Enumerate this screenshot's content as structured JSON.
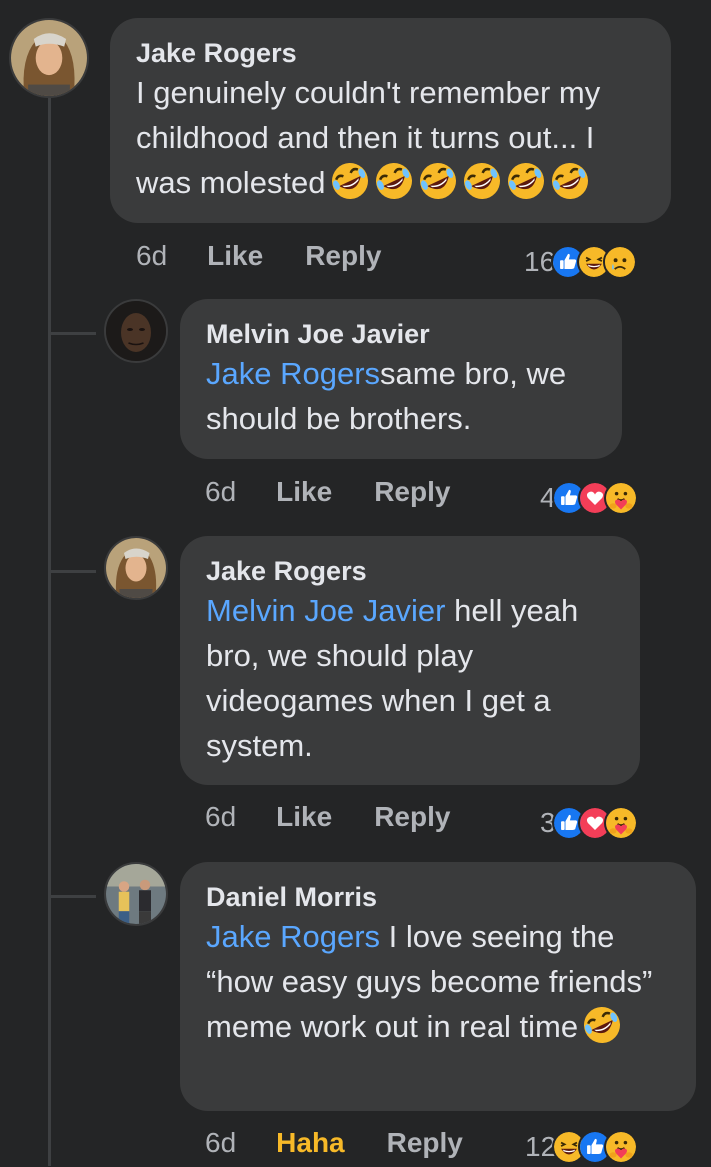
{
  "comments": [
    {
      "author": "Jake Rogers",
      "text": "I genuinely couldn't remember my childhood and then it turns out... I was molested",
      "trailing_emoji": [
        "rofl-emoji",
        "rofl-emoji",
        "rofl-emoji",
        "rofl-emoji",
        "rofl-emoji",
        "rofl-emoji"
      ],
      "time": "6d",
      "like_label": "Like",
      "reply_label": "Reply",
      "reaction_count": "16",
      "reactions": [
        "like-icon",
        "laugh-icon",
        "sad-icon"
      ]
    },
    {
      "author": "Melvin Joe Javier",
      "mention": "Jake Rogers",
      "text": "same bro, we should be brothers.",
      "time": "6d",
      "like_label": "Like",
      "reply_label": "Reply",
      "reaction_count": "4",
      "reactions": [
        "like-icon",
        "love-icon",
        "care-icon"
      ]
    },
    {
      "author": "Jake Rogers",
      "mention": "Melvin Joe Javier",
      "text": " hell yeah bro, we should play videogames when I get a system.",
      "time": "6d",
      "like_label": "Like",
      "reply_label": "Reply",
      "reaction_count": "3",
      "reactions": [
        "like-icon",
        "love-icon",
        "care-icon"
      ]
    },
    {
      "author": "Daniel Morris",
      "mention": "Jake Rogers",
      "text": " I love seeing the “how easy guys become friends” meme work out in real time",
      "trailing_emoji": [
        "rofl-emoji"
      ],
      "time": "6d",
      "like_label": "Haha",
      "reply_label": "Reply",
      "reaction_count": "12",
      "reactions": [
        "laugh-icon",
        "like-icon",
        "care-icon"
      ]
    }
  ],
  "colors": {
    "background": "#242526",
    "bubble": "#3a3b3c",
    "mention": "#5aa7ff",
    "haha": "#f7b928",
    "like": "#1877f2",
    "love": "#f33e58"
  }
}
